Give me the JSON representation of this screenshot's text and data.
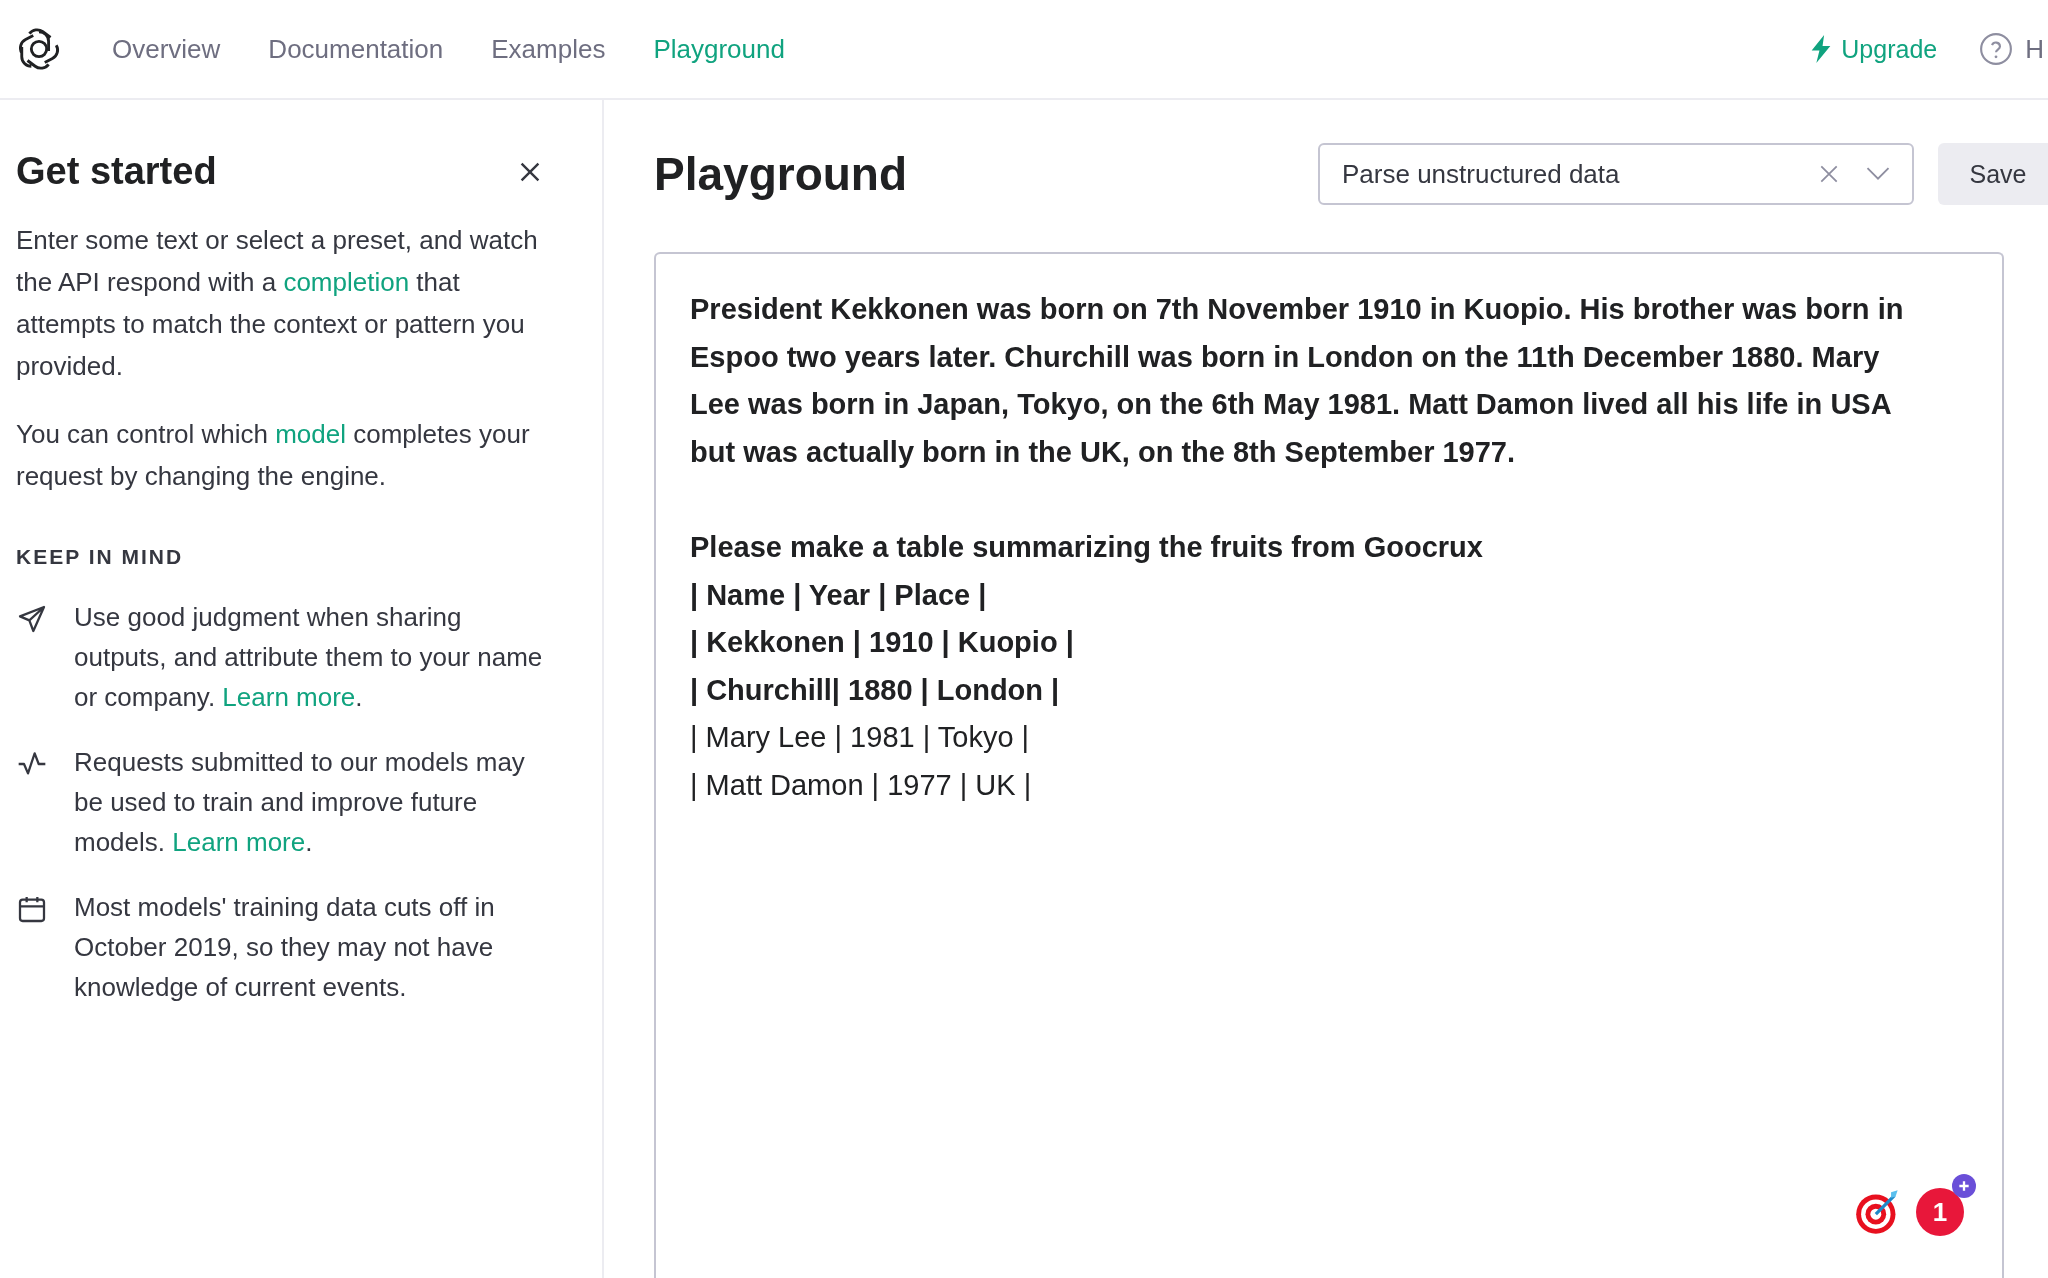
{
  "nav": {
    "items": [
      {
        "label": "Overview",
        "selected": false
      },
      {
        "label": "Documentation",
        "selected": false
      },
      {
        "label": "Examples",
        "selected": false
      },
      {
        "label": "Playground",
        "selected": true
      }
    ],
    "upgrade": "Upgrade",
    "help": "H"
  },
  "sidebar": {
    "title": "Get started",
    "paragraphs": [
      [
        {
          "text": "Enter some text or select a preset, and watch the API respond with a "
        },
        {
          "text": "completion",
          "kind": "link"
        },
        {
          "text": " that attempts to match the context or pattern you provided."
        }
      ],
      [
        {
          "text": "You can control which "
        },
        {
          "text": "model",
          "kind": "link"
        },
        {
          "text": " completes your request by changing the engine."
        }
      ]
    ],
    "section_title": "KEEP IN MIND",
    "tips": [
      {
        "parts": [
          {
            "text": "Use good judgment when sharing outputs, and attribute them to your name or company. "
          },
          {
            "text": "Learn more",
            "kind": "link"
          },
          {
            "text": "."
          }
        ]
      },
      {
        "parts": [
          {
            "text": "Requests submitted to our models may be used to train and improve future models. "
          },
          {
            "text": "Learn more",
            "kind": "link"
          },
          {
            "text": "."
          }
        ]
      },
      {
        "parts": [
          {
            "text": "Most models' training data cuts off in October 2019, so they may not have knowledge of current events."
          }
        ]
      }
    ]
  },
  "header": {
    "title": "Playground",
    "preset": "Parse unstructured data",
    "save": "Save"
  },
  "editor": {
    "lines": [
      {
        "kind": "prompt",
        "text": "President Kekkonen was born on 7th November 1910 in Kuopio. His brother was born in"
      },
      {
        "kind": "prompt",
        "text": "Espoo two years later. Churchill was born in London on the 11th December 1880. Mary"
      },
      {
        "kind": "prompt",
        "text": "Lee was born in Japan, Tokyo, on the 6th May 1981. Matt Damon lived all his life in USA"
      },
      {
        "kind": "prompt",
        "text": "but was actually born in the UK, on the 8th September 1977."
      },
      {
        "kind": "blank"
      },
      {
        "kind": "prompt",
        "text": "Please make a table summarizing the fruits from Goocrux"
      },
      {
        "kind": "prompt",
        "text": "| Name | Year | Place |"
      },
      {
        "kind": "prompt",
        "text": "| Kekkonen | 1910 | Kuopio |"
      },
      {
        "kind": "prompt",
        "text": "| Churchill| 1880 | London |"
      },
      {
        "kind": "completion",
        "text": "| Mary Lee | 1981 | Tokyo |"
      },
      {
        "kind": "completion",
        "text": "| Matt Damon | 1977 | UK |"
      }
    ],
    "badge_count": "1"
  }
}
